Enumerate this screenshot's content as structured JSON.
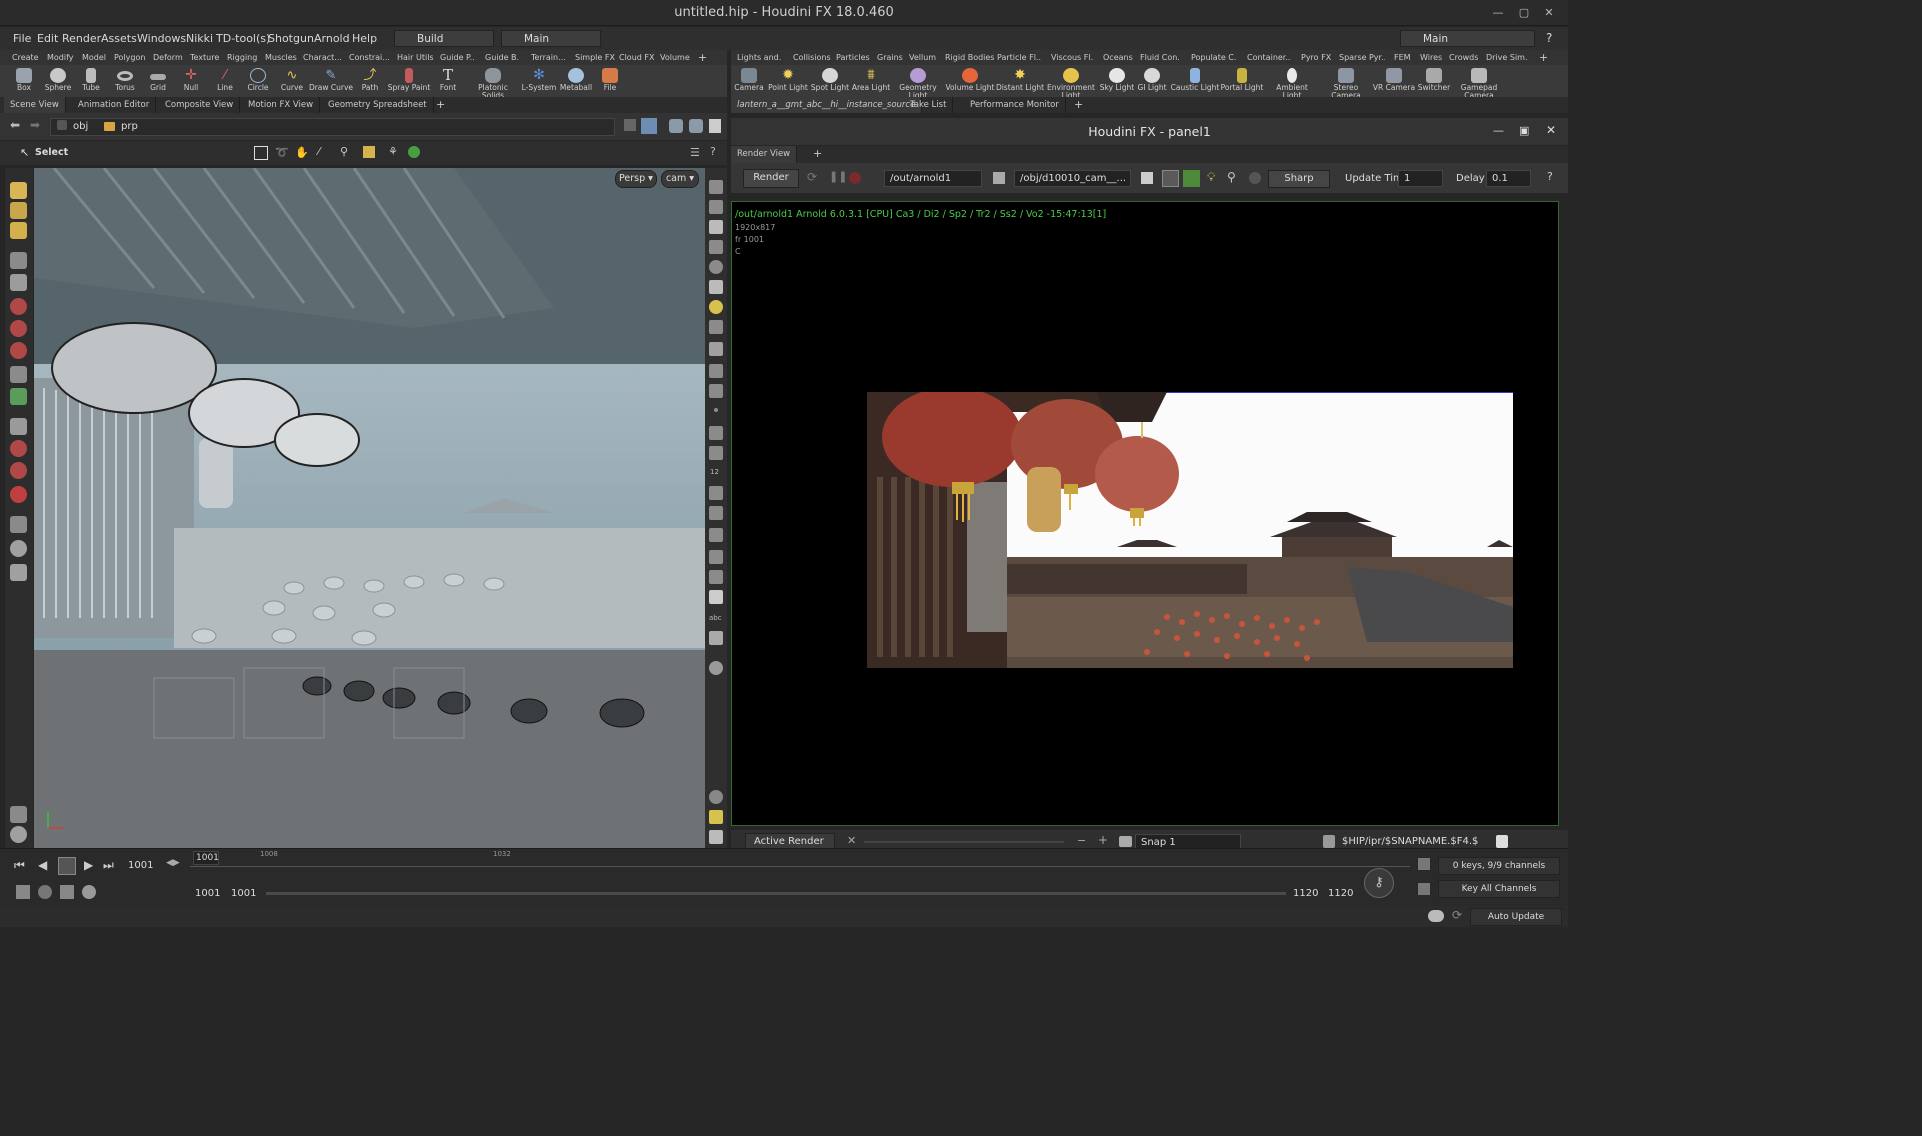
{
  "window": {
    "title": "untitled.hip - Houdini FX 18.0.460"
  },
  "menu": [
    "File",
    "Edit",
    "Render",
    "Assets",
    "Windows",
    "Nikki",
    "TD-tool(s)",
    "Shotgun",
    "Arnold",
    "Help"
  ],
  "desktop": {
    "build": "Build",
    "main": "Main",
    "right_main": "Main"
  },
  "shelf_left_tabs": [
    "Create",
    "Modify",
    "Model",
    "Polygon",
    "Deform",
    "Texture",
    "Rigging",
    "Muscles",
    "Charact...",
    "Constrai...",
    "Hair Utils",
    "Guide P...",
    "Guide B...",
    "Terrain...",
    "Simple FX",
    "Cloud FX",
    "Volume"
  ],
  "shelf_left_tools": [
    "Box",
    "Sphere",
    "Tube",
    "Torus",
    "Grid",
    "Null",
    "Line",
    "Circle",
    "Curve",
    "Draw Curve",
    "Path",
    "Spray Paint",
    "Font",
    "Platonic Solids",
    "L-System",
    "Metaball",
    "File"
  ],
  "shelf_right_tabs": [
    "Lights and...",
    "Collisions",
    "Particles",
    "Grains",
    "Vellum",
    "Rigid Bodies",
    "Particle Fl...",
    "Viscous Fl...",
    "Oceans",
    "Fluid Con...",
    "Populate C...",
    "Container...",
    "Pyro FX",
    "Sparse Pyr...",
    "FEM",
    "Wires",
    "Crowds",
    "Drive Sim..."
  ],
  "shelf_right_tools": [
    "Camera",
    "Point Light",
    "Spot Light",
    "Area Light",
    "Geometry Light",
    "Volume Light",
    "Distant Light",
    "Environment Light",
    "Sky Light",
    "GI Light",
    "Caustic Light",
    "Portal Light",
    "Ambient Light",
    "Stereo Camera",
    "VR Camera",
    "Switcher",
    "Gamepad Camera"
  ],
  "left_panel_tabs": [
    "Scene View",
    "Animation Editor",
    "Composite View",
    "Motion FX View",
    "Geometry Spreadsheet"
  ],
  "path": {
    "obj": "obj",
    "prp": "prp"
  },
  "select_label": "Select",
  "viewport": {
    "persp": "Persp",
    "cam": "cam"
  },
  "right_panel_tabs": [
    "lantern_a__gmt_abc__hi__instance_source",
    "Take List",
    "Performance Monitor"
  ],
  "floating_title": "Houdini FX - panel1",
  "render_view": {
    "tab": "Render View",
    "render_btn": "Render",
    "rop": "/out/arnold1",
    "camera": "/obj/d10010_cam__...",
    "sharp": "Sharp",
    "update_label": "Update Time",
    "update_val": "1",
    "delay_label": "Delay",
    "delay_val": "0.1"
  },
  "render_info": {
    "line1": "/out/arnold1  Arnold 6.0.3.1 [CPU]  Ca3 / Di2 / Sp2 / Tr2 / Ss2 / Vo2 -15:47:13[1]",
    "line2": "1920x817",
    "line3": "fr 1001",
    "line4": "C"
  },
  "render_bottom": {
    "active": "Active Render",
    "snap": "Snap",
    "snap_val": "1",
    "path": "$HIP/ipr/$SNAPNAME.$F4.$"
  },
  "timeline": {
    "frame": "1001",
    "field": "1001",
    "start1": "1001",
    "start2": "1001",
    "end1": "1120",
    "end2": "1120",
    "ticks": [
      "1008",
      "1032"
    ],
    "keys": "0 keys, 9/9 channels",
    "key_all": "Key All Channels"
  },
  "status": {
    "auto_update": "Auto Update"
  }
}
